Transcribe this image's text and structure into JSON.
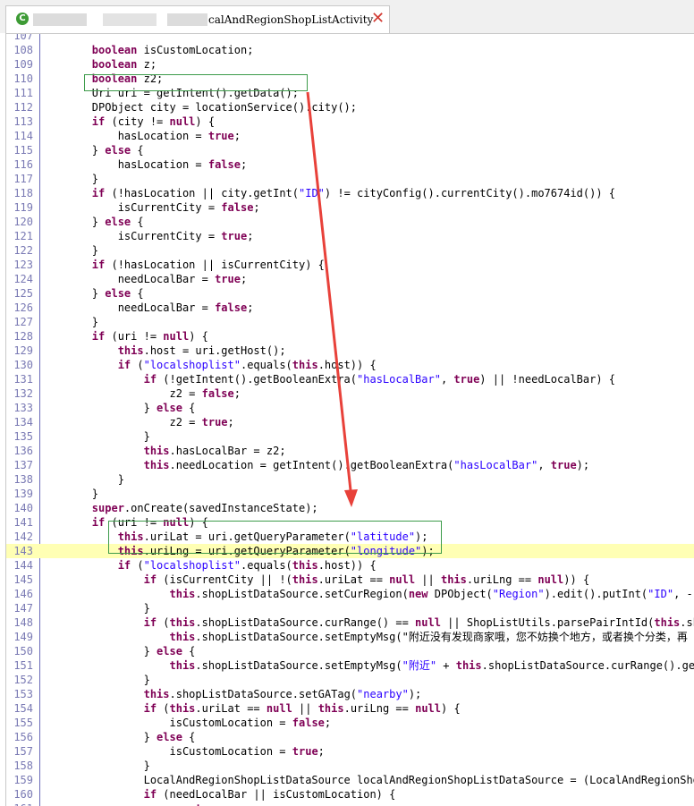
{
  "tab": {
    "title": "calAndRegionShopListActivity",
    "icon": "class-icon",
    "close_icon": "close-icon"
  },
  "editor": {
    "highlighted_line": "143",
    "annotation_color": "#3d9b4a",
    "arrow_color": "#e8413a",
    "lines": [
      {
        "n": "107",
        "code": ""
      },
      {
        "n": "108",
        "code": "        boolean isCustomLocation;"
      },
      {
        "n": "109",
        "code": "        boolean z;"
      },
      {
        "n": "110",
        "code": "        boolean z2;"
      },
      {
        "n": "111",
        "code": "        Uri uri = getIntent().getData();"
      },
      {
        "n": "112",
        "code": "        DPObject city = locationService().city();"
      },
      {
        "n": "113",
        "code": "        if (city != null) {"
      },
      {
        "n": "114",
        "code": "            hasLocation = true;"
      },
      {
        "n": "115",
        "code": "        } else {"
      },
      {
        "n": "116",
        "code": "            hasLocation = false;"
      },
      {
        "n": "117",
        "code": "        }"
      },
      {
        "n": "118",
        "code": "        if (!hasLocation || city.getInt(\"ID\") != cityConfig().currentCity().mo7674id()) {"
      },
      {
        "n": "119",
        "code": "            isCurrentCity = false;"
      },
      {
        "n": "120",
        "code": "        } else {"
      },
      {
        "n": "121",
        "code": "            isCurrentCity = true;"
      },
      {
        "n": "122",
        "code": "        }"
      },
      {
        "n": "123",
        "code": "        if (!hasLocation || isCurrentCity) {"
      },
      {
        "n": "124",
        "code": "            needLocalBar = true;"
      },
      {
        "n": "125",
        "code": "        } else {"
      },
      {
        "n": "126",
        "code": "            needLocalBar = false;"
      },
      {
        "n": "127",
        "code": "        }"
      },
      {
        "n": "128",
        "code": "        if (uri != null) {"
      },
      {
        "n": "129",
        "code": "            this.host = uri.getHost();"
      },
      {
        "n": "130",
        "code": "            if (\"localshoplist\".equals(this.host)) {"
      },
      {
        "n": "131",
        "code": "                if (!getIntent().getBooleanExtra(\"hasLocalBar\", true) || !needLocalBar) {"
      },
      {
        "n": "132",
        "code": "                    z2 = false;"
      },
      {
        "n": "133",
        "code": "                } else {"
      },
      {
        "n": "134",
        "code": "                    z2 = true;"
      },
      {
        "n": "135",
        "code": "                }"
      },
      {
        "n": "136",
        "code": "                this.hasLocalBar = z2;"
      },
      {
        "n": "137",
        "code": "                this.needLocation = getIntent().getBooleanExtra(\"hasLocalBar\", true);"
      },
      {
        "n": "138",
        "code": "            }"
      },
      {
        "n": "139",
        "code": "        }"
      },
      {
        "n": "140",
        "code": "        super.onCreate(savedInstanceState);"
      },
      {
        "n": "141",
        "code": "        if (uri != null) {"
      },
      {
        "n": "142",
        "code": "            this.uriLat = uri.getQueryParameter(\"latitude\");"
      },
      {
        "n": "143",
        "code": "            this.uriLng = uri.getQueryParameter(\"longitude\");"
      },
      {
        "n": "144",
        "code": "            if (\"localshoplist\".equals(this.host)) {"
      },
      {
        "n": "145",
        "code": "                if (isCurrentCity || !(this.uriLat == null || this.uriLng == null)) {"
      },
      {
        "n": "146",
        "code": "                    this.shopListDataSource.setCurRegion(new DPObject(\"Region\").edit().putInt(\"ID\", -1).p"
      },
      {
        "n": "147",
        "code": "                }"
      },
      {
        "n": "148",
        "code": "                if (this.shopListDataSource.curRange() == null || ShopListUtils.parsePairIntId(this.shopL"
      },
      {
        "n": "149",
        "code": "                    this.shopListDataSource.setEmptyMsg(\"附近没有发现商家哦，您不妨换个地方，或者换个分类，再"
      },
      {
        "n": "150",
        "code": "                } else {"
      },
      {
        "n": "151",
        "code": "                    this.shopListDataSource.setEmptyMsg(\"附近\" + this.shopListDataSource.curRange().getSt"
      },
      {
        "n": "152",
        "code": "                }"
      },
      {
        "n": "153",
        "code": "                this.shopListDataSource.setGATag(\"nearby\");"
      },
      {
        "n": "154",
        "code": "                if (this.uriLat == null || this.uriLng == null) {"
      },
      {
        "n": "155",
        "code": "                    isCustomLocation = false;"
      },
      {
        "n": "156",
        "code": "                } else {"
      },
      {
        "n": "157",
        "code": "                    isCustomLocation = true;"
      },
      {
        "n": "158",
        "code": "                }"
      },
      {
        "n": "159",
        "code": "                LocalAndRegionShopListDataSource localAndRegionShopListDataSource = (LocalAndRegionShopLi"
      },
      {
        "n": "160",
        "code": "                if (needLocalBar || isCustomLocation) {"
      },
      {
        "n": "161",
        "code": "                    z = true;"
      }
    ]
  }
}
